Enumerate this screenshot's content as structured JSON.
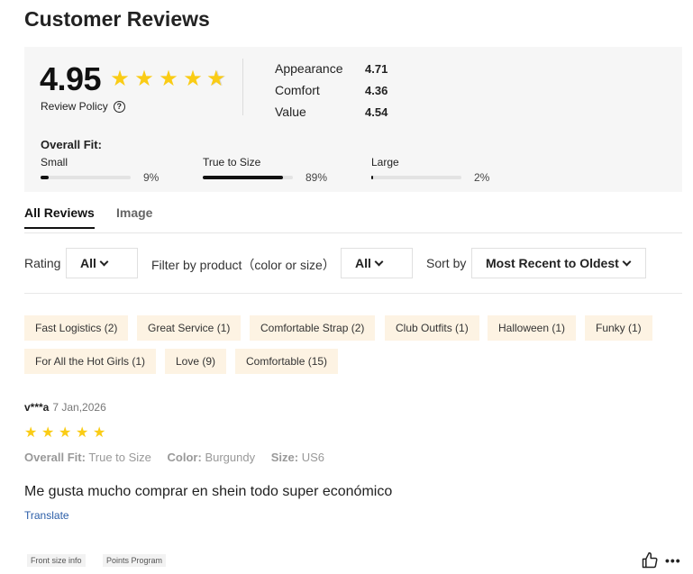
{
  "page": {
    "title": "Customer Reviews"
  },
  "summary": {
    "score": "4.95",
    "rating_stars": 4.95,
    "review_policy": "Review Policy",
    "metrics": [
      {
        "label": "Appearance",
        "value": "4.71"
      },
      {
        "label": "Comfort",
        "value": "4.36"
      },
      {
        "label": "Value",
        "value": "4.54"
      }
    ],
    "fit_title": "Overall Fit:",
    "fit": [
      {
        "label": "Small",
        "percent_text": "9%",
        "fraction": 0.09
      },
      {
        "label": "True to Size",
        "percent_text": "89%",
        "fraction": 0.89
      },
      {
        "label": "Large",
        "percent_text": "2%",
        "fraction": 0.02
      }
    ]
  },
  "tabs": [
    {
      "label": "All Reviews",
      "active": true
    },
    {
      "label": "Image",
      "active": false
    }
  ],
  "filters": {
    "rating_label": "Rating",
    "rating_value": "All",
    "product_label": "Filter by product（color or size）",
    "product_value": "All",
    "sort_label": "Sort by",
    "sort_value": "Most Recent to Oldest"
  },
  "tags": [
    "Fast Logistics (2)",
    "Great Service (1)",
    "Comfortable Strap (2)",
    "Club Outfits (1)",
    "Halloween (1)",
    "Funky (1)",
    "For All the Hot Girls (1)",
    "Love (9)",
    "Comfortable (15)"
  ],
  "review": {
    "user": "v***a",
    "date": "7 Jan,2026",
    "stars": 5,
    "fit_key": "Overall Fit:",
    "fit_value": "True to Size",
    "color_key": "Color:",
    "color_value": "Burgundy",
    "size_key": "Size:",
    "size_value": "US6",
    "text": "Me gusta mucho comprar en shein todo super económico",
    "translate": "Translate"
  },
  "footer": {
    "badge_1": "Front size info",
    "badge_2": "Points Program"
  },
  "colors": {
    "star": "#facc15",
    "tag_bg": "#fdf3e3",
    "panel_bg": "#f6f6f6",
    "link": "#2b5ea8"
  },
  "icons": [
    "star-icon",
    "help-circle-icon",
    "chevron-down-icon",
    "thumbs-up-icon",
    "more-dots-icon"
  ]
}
